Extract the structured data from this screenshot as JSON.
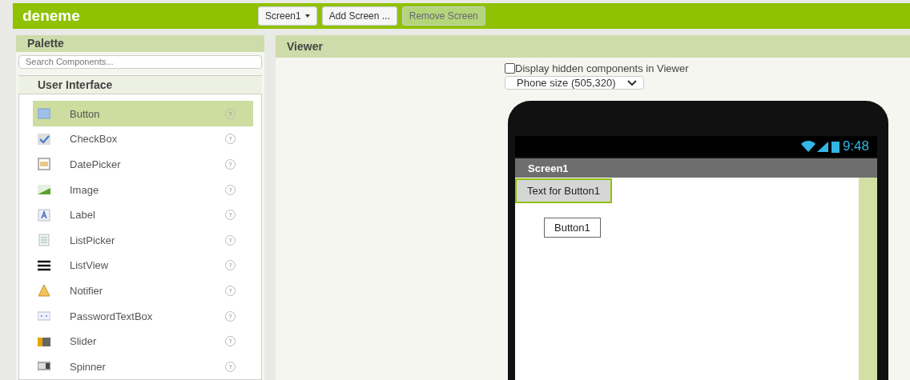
{
  "app": {
    "title": "deneme"
  },
  "toolbar": [
    {
      "label": "Screen1",
      "kind": "dropdown",
      "disabled": false
    },
    {
      "label": "Add Screen ...",
      "kind": "button",
      "disabled": false
    },
    {
      "label": "Remove Screen",
      "kind": "button",
      "disabled": true
    }
  ],
  "palette": {
    "title": "Palette",
    "search": {
      "placeholder": "Search Components..."
    },
    "category": "User Interface",
    "items": [
      {
        "label": "Button",
        "kind": "button",
        "selected": true,
        "help": "?"
      },
      {
        "label": "CheckBox",
        "kind": "checkbox",
        "selected": false,
        "help": "?"
      },
      {
        "label": "DatePicker",
        "kind": "datepicker",
        "selected": false,
        "help": "?"
      },
      {
        "label": "Image",
        "kind": "image",
        "selected": false,
        "help": "?"
      },
      {
        "label": "Label",
        "kind": "label",
        "selected": false,
        "help": "?"
      },
      {
        "label": "ListPicker",
        "kind": "listpicker",
        "selected": false,
        "help": "?"
      },
      {
        "label": "ListView",
        "kind": "listview",
        "selected": false,
        "help": "?"
      },
      {
        "label": "Notifier",
        "kind": "notifier",
        "selected": false,
        "help": "?"
      },
      {
        "label": "PasswordTextBox",
        "kind": "password",
        "selected": false,
        "help": "?"
      },
      {
        "label": "Slider",
        "kind": "slider",
        "selected": false,
        "help": "?"
      },
      {
        "label": "Spinner",
        "kind": "spinner",
        "selected": false,
        "help": "?"
      }
    ]
  },
  "viewer": {
    "title": "Viewer",
    "hidden_toggle": {
      "label": "Display hidden components in Viewer",
      "checked": false
    },
    "size_select": {
      "value": "Phone size (505,320)"
    },
    "phone": {
      "time": "9:48",
      "screen_title": "Screen1",
      "components": [
        {
          "label": "Text for Button1",
          "selected": true
        },
        {
          "label": "Button1",
          "selected": false
        }
      ]
    }
  }
}
